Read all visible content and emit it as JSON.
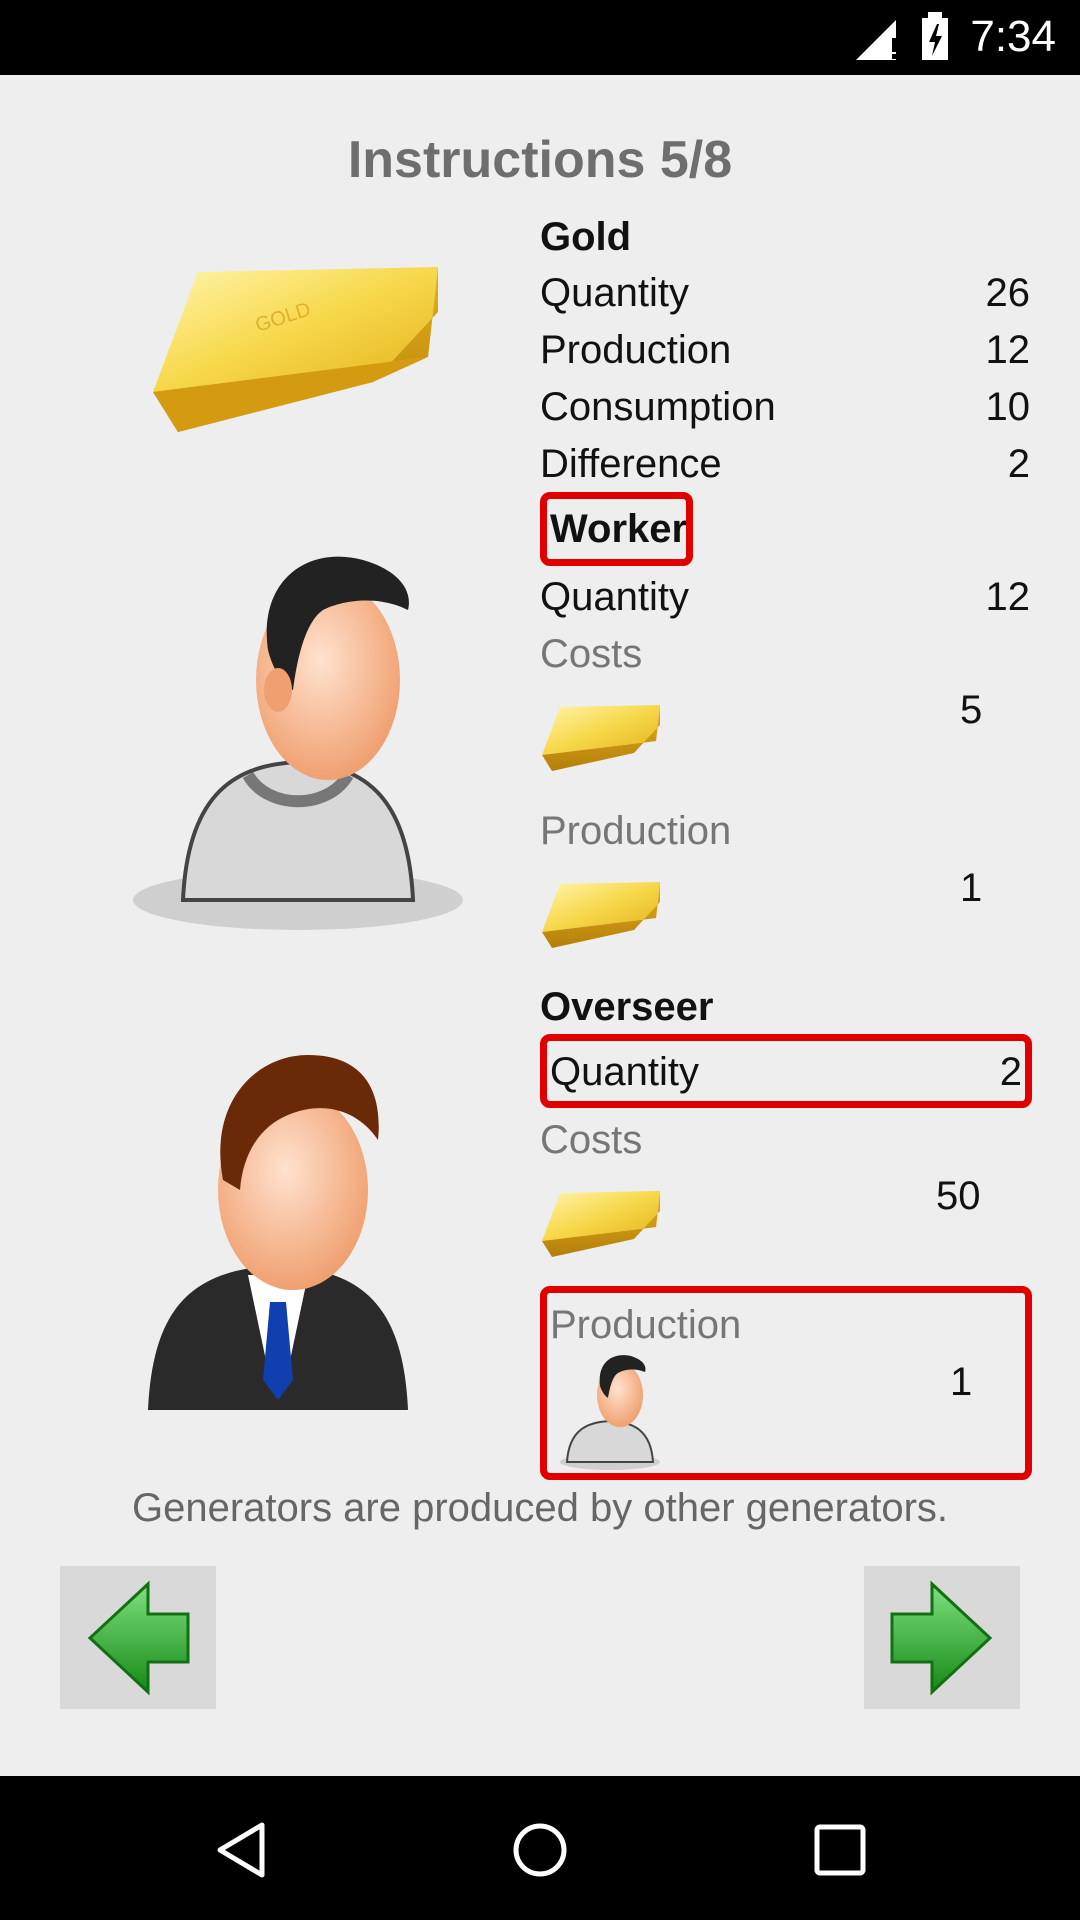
{
  "status_bar": {
    "time": "7:34"
  },
  "title": "Instructions 5/8",
  "gold": {
    "name": "Gold",
    "stats": [
      {
        "label": "Quantity",
        "value": "26"
      },
      {
        "label": "Production",
        "value": "12"
      },
      {
        "label": "Consumption",
        "value": "10"
      },
      {
        "label": "Difference",
        "value": "2"
      }
    ]
  },
  "worker": {
    "name": "Worker",
    "quantity_label": "Quantity",
    "quantity_value": "12",
    "costs_label": "Costs",
    "cost_value": "5",
    "production_label": "Production",
    "production_value": "1"
  },
  "overseer": {
    "name": "Overseer",
    "quantity_label": "Quantity",
    "quantity_value": "2",
    "costs_label": "Costs",
    "cost_value": "50",
    "production_label": "Production",
    "production_value": "1"
  },
  "caption": "Generators are produced by other generators.",
  "nav": {
    "back_icon": "green-left-arrow-icon",
    "next_icon": "green-right-arrow-icon"
  },
  "colors": {
    "highlight": "#e00000",
    "arrow_green": "#2ea82e",
    "gold": "#f2c41a"
  }
}
